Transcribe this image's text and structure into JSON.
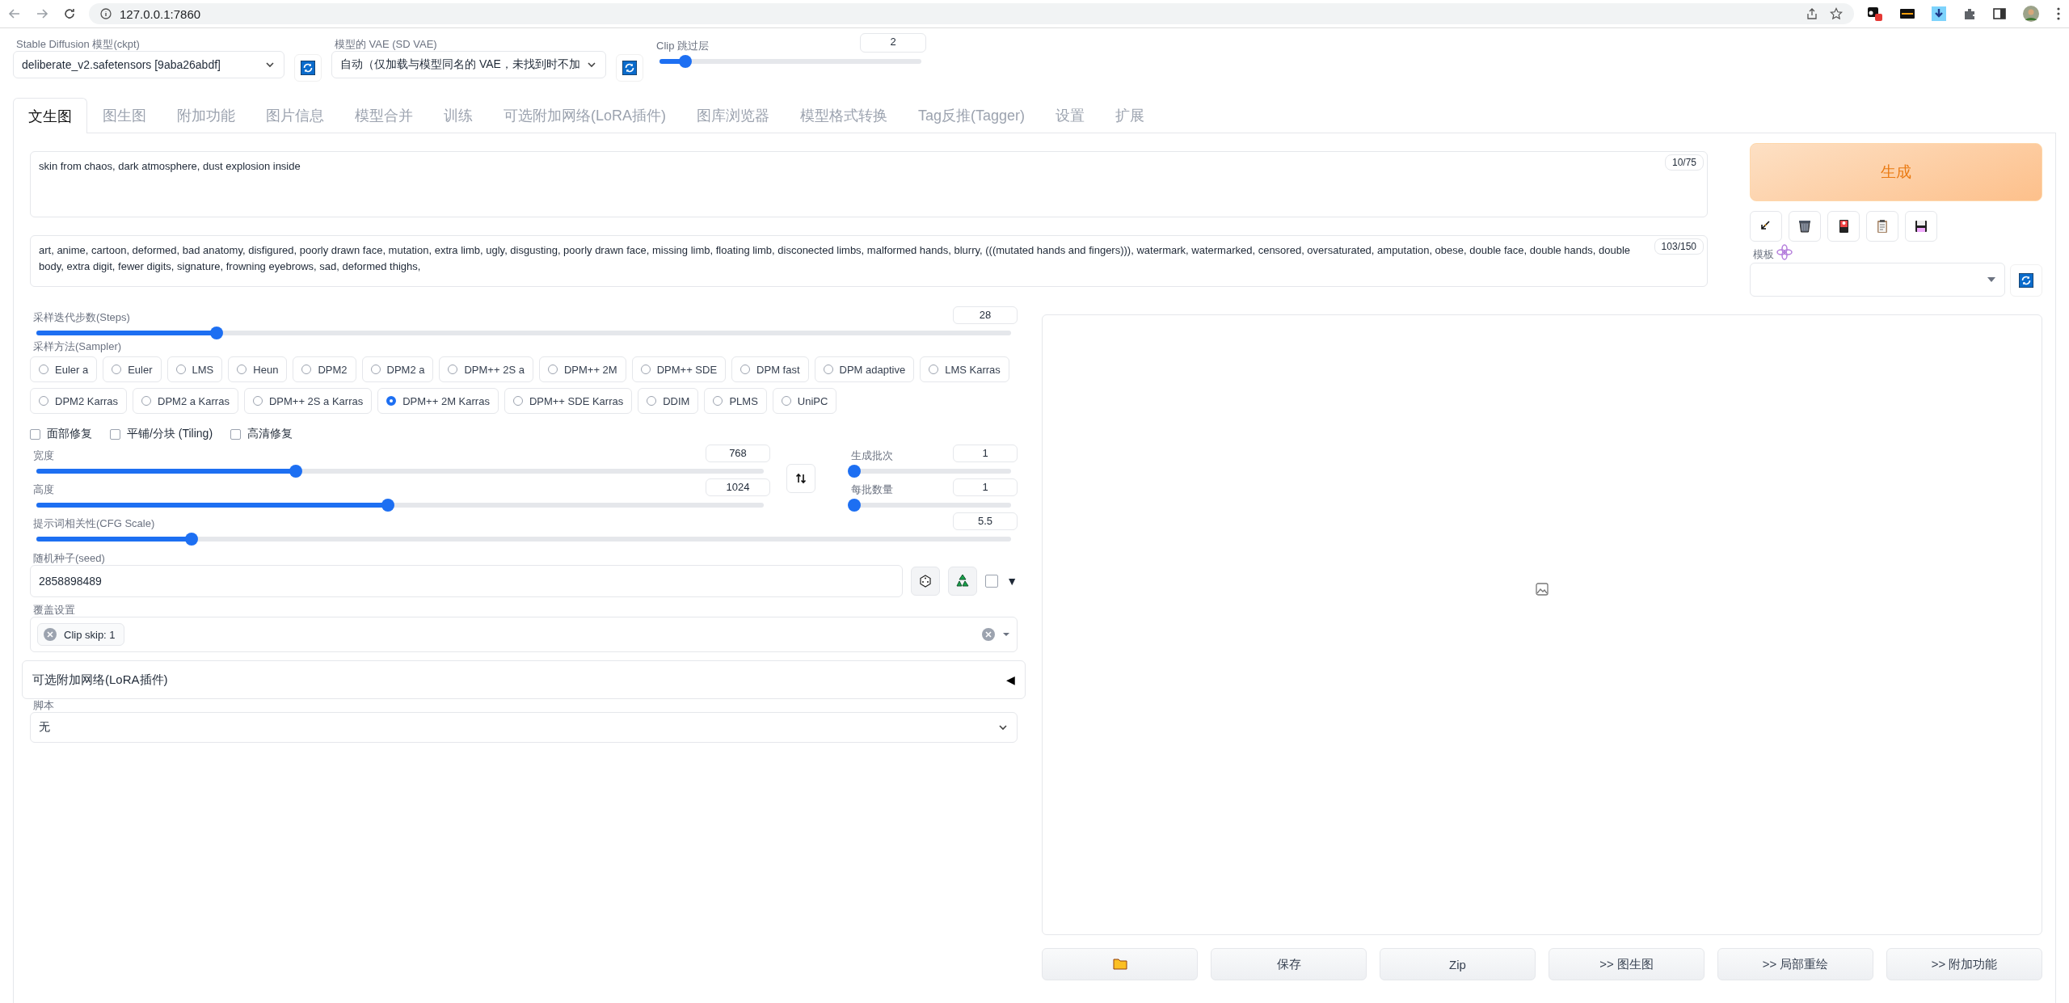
{
  "browser": {
    "url": "127.0.0.1:7860"
  },
  "top": {
    "model": {
      "label": "Stable Diffusion 模型(ckpt)",
      "value": "deliberate_v2.safetensors [9aba26abdf]"
    },
    "vae": {
      "label": "模型的 VAE (SD VAE)",
      "value": "自动（仅加载与模型同名的 VAE，未找到时不加"
    },
    "clip": {
      "label": "Clip 跳过层",
      "value": "2",
      "level": 0.1
    }
  },
  "tabs": [
    {
      "label": "文生图",
      "selected": true
    },
    {
      "label": "图生图",
      "selected": false
    },
    {
      "label": "附加功能",
      "selected": false
    },
    {
      "label": "图片信息",
      "selected": false
    },
    {
      "label": "模型合并",
      "selected": false
    },
    {
      "label": "训练",
      "selected": false
    },
    {
      "label": "可选附加网络(LoRA插件)",
      "selected": false
    },
    {
      "label": "图库浏览器",
      "selected": false
    },
    {
      "label": "模型格式转换",
      "selected": false
    },
    {
      "label": "Tag反推(Tagger)",
      "selected": false
    },
    {
      "label": "设置",
      "selected": false
    },
    {
      "label": "扩展",
      "selected": false
    }
  ],
  "prompt": {
    "text": "skin from chaos, dark atmosphere, dust explosion inside",
    "counter": "10/75"
  },
  "negative_prompt": {
    "text": "art, anime, cartoon, deformed, bad anatomy, disfigured, poorly drawn face, mutation, extra limb, ugly, disgusting, poorly drawn face, missing limb, floating limb, disconected limbs, malformed hands, blurry, (((mutated hands and fingers))), watermark, watermarked, censored, oversaturated, amputation, obese, double face, double hands, double body, extra digit, fewer digits, signature, frowning eyebrows, sad, deformed thighs,",
    "counter": "103/150"
  },
  "generate": {
    "label": "生成"
  },
  "template": {
    "label": "模板"
  },
  "steps": {
    "label": "采样迭代步数(Steps)",
    "value": "28",
    "level": 0.185
  },
  "sampler": {
    "label": "采样方法(Sampler)",
    "options": [
      {
        "label": "Euler a",
        "selected": false
      },
      {
        "label": "Euler",
        "selected": false
      },
      {
        "label": "LMS",
        "selected": false
      },
      {
        "label": "Heun",
        "selected": false
      },
      {
        "label": "DPM2",
        "selected": false
      },
      {
        "label": "DPM2 a",
        "selected": false
      },
      {
        "label": "DPM++ 2S a",
        "selected": false
      },
      {
        "label": "DPM++ 2M",
        "selected": false
      },
      {
        "label": "DPM++ SDE",
        "selected": false
      },
      {
        "label": "DPM fast",
        "selected": false
      },
      {
        "label": "DPM adaptive",
        "selected": false
      },
      {
        "label": "LMS Karras",
        "selected": false
      },
      {
        "label": "DPM2 Karras",
        "selected": false
      },
      {
        "label": "DPM2 a Karras",
        "selected": false
      },
      {
        "label": "DPM++ 2S a Karras",
        "selected": false
      },
      {
        "label": "DPM++ 2M Karras",
        "selected": true
      },
      {
        "label": "DPM++ SDE Karras",
        "selected": false
      },
      {
        "label": "DDIM",
        "selected": false
      },
      {
        "label": "PLMS",
        "selected": false
      },
      {
        "label": "UniPC",
        "selected": false
      }
    ]
  },
  "options": [
    {
      "label": "面部修复",
      "checked": false
    },
    {
      "label": "平铺/分块 (Tiling)",
      "checked": false
    },
    {
      "label": "高清修复",
      "checked": false
    }
  ],
  "width": {
    "label": "宽度",
    "value": "768",
    "level": 0.357
  },
  "height": {
    "label": "高度",
    "value": "1024",
    "level": 0.483
  },
  "batch_count": {
    "label": "生成批次",
    "value": "1",
    "level": 0
  },
  "batch_size": {
    "label": "每批数量",
    "value": "1",
    "level": 0
  },
  "cfg": {
    "label": "提示词相关性(CFG Scale)",
    "value": "5.5",
    "level": 0.159
  },
  "seed": {
    "label": "随机种子(seed)",
    "value": "2858898489",
    "extra_checked": false,
    "expander": "▼"
  },
  "override": {
    "label": "覆盖设置",
    "tags": [
      {
        "text": "Clip skip: 1"
      }
    ]
  },
  "lora": {
    "title": "可选附加网络(LoRA插件)",
    "toggle": "◀"
  },
  "script": {
    "label": "脚本",
    "value": "无"
  },
  "output_buttons": [
    {
      "kind": "folder"
    },
    {
      "kind": "text",
      "label": "保存"
    },
    {
      "kind": "text",
      "label": "Zip"
    },
    {
      "kind": "text",
      "label": ">> 图生图"
    },
    {
      "kind": "text",
      "label": ">> 局部重绘"
    },
    {
      "kind": "text",
      "label": ">> 附加功能"
    }
  ]
}
